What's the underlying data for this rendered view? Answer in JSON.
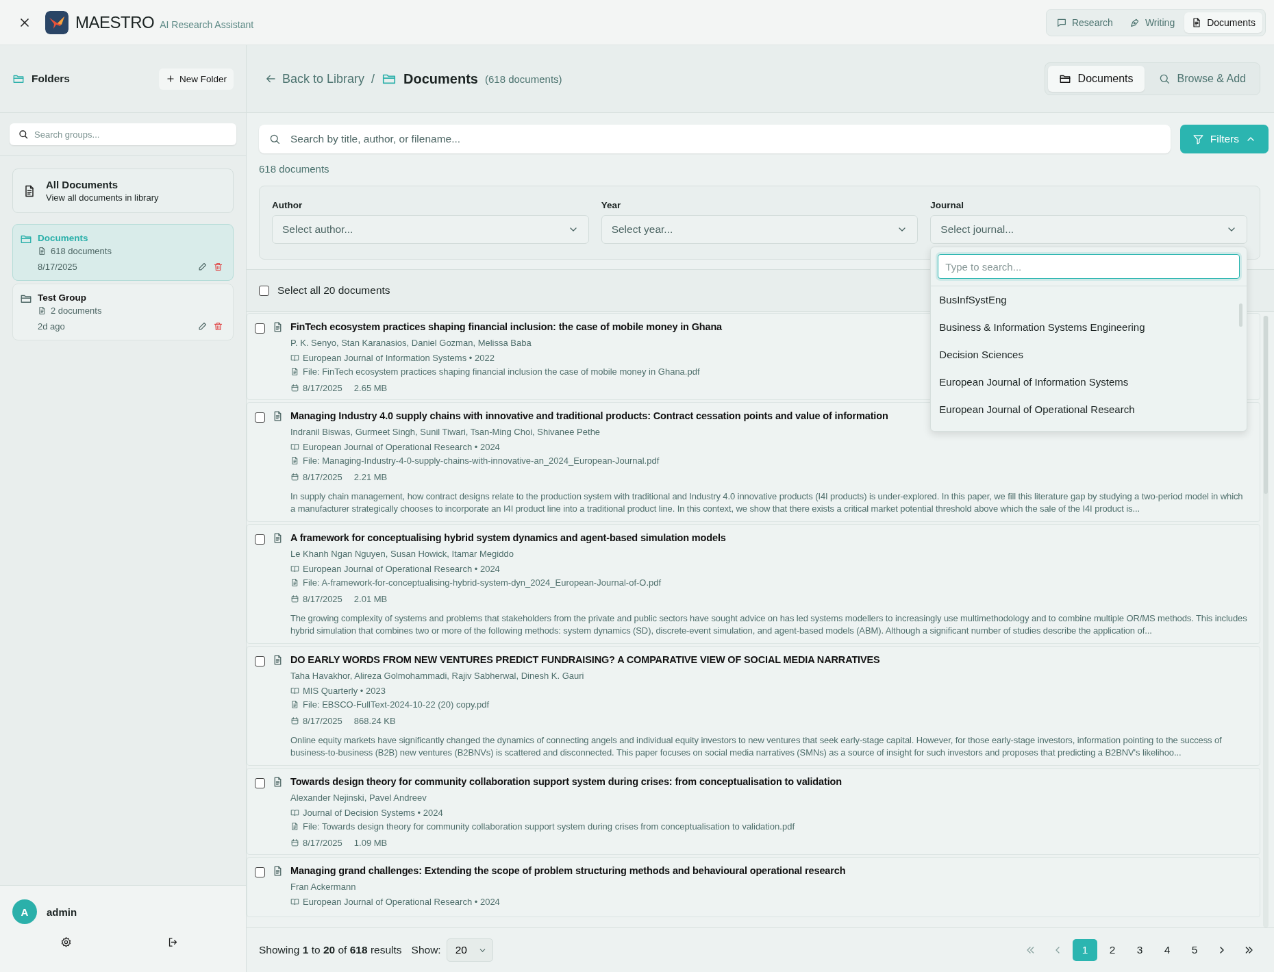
{
  "app": {
    "title": "MAESTRO",
    "subtitle": "AI Research Assistant"
  },
  "nav_tabs": [
    {
      "label": "Research",
      "selected": false,
      "kind": "chat"
    },
    {
      "label": "Writing",
      "selected": false,
      "kind": "pen"
    },
    {
      "label": "Documents",
      "selected": true,
      "kind": "doc"
    }
  ],
  "sidebar": {
    "title": "Folders",
    "new_folder_button": "New Folder",
    "search_placeholder": "Search groups...",
    "all_documents": {
      "title": "All Documents",
      "subtitle": "View all documents in library"
    },
    "groups": [
      {
        "name": "Documents",
        "count": "618 documents",
        "date": "8/17/2025",
        "selected": true
      },
      {
        "name": "Test Group",
        "count": "2 documents",
        "date": "2d ago",
        "selected": false
      }
    ],
    "user": {
      "avatar": "A",
      "name": "admin"
    }
  },
  "main": {
    "back_link": "Back to Library",
    "separator": "/",
    "title": "Documents",
    "count": "(618 documents)",
    "view_tabs": [
      {
        "label": "Documents",
        "selected": true,
        "kind": "folder"
      },
      {
        "label": "Browse & Add",
        "selected": false,
        "kind": "search"
      }
    ],
    "search_placeholder": "Search by title, author, or filename...",
    "filters_button": "Filters",
    "filters_expanded": true,
    "result_count": "618 documents",
    "filters": [
      {
        "label": "Author",
        "placeholder": "Select author...",
        "open": false
      },
      {
        "label": "Year",
        "placeholder": "Select year...",
        "open": false
      },
      {
        "label": "Journal",
        "placeholder": "Select journal...",
        "open": true
      }
    ],
    "dropdown": {
      "placeholder": "Type to search...",
      "options": [
        "BusInfSystEng",
        "Business & Information Systems Engineering",
        "Decision Sciences",
        "European Journal of Information Systems",
        "European Journal of Operational Research"
      ]
    },
    "select_all": {
      "label": "Select all 20 documents",
      "checked": false
    },
    "documents": [
      {
        "title": "FinTech ecosystem practices shaping financial inclusion: the case of mobile money in Ghana",
        "authors": "P. K. Senyo, Stan Karanasios, Daniel Gozman, Melissa Baba",
        "journal": "European Journal of Information Systems • 2022",
        "file": "File: FinTech ecosystem practices shaping financial inclusion the case of mobile money in Ghana.pdf",
        "date": "8/17/2025",
        "size": "2.65 MB",
        "checked": false
      },
      {
        "title": "Managing Industry 4.0 supply chains with innovative and traditional products: Contract cessation points and value of information",
        "authors": "Indranil Biswas, Gurmeet Singh, Sunil Tiwari, Tsan-Ming Choi, Shivanee Pethe",
        "journal": "European Journal of Operational Research • 2024",
        "file": "File: Managing-Industry-4-0-supply-chains-with-innovative-an_2024_European-Journal.pdf",
        "date": "8/17/2025",
        "size": "2.21 MB",
        "checked": false,
        "abstract": "In supply chain management, how contract designs relate to the production system with traditional and Industry 4.0 innovative products (I4I products) is under-explored. In this paper, we fill this literature gap by studying a two-period model in which a manufacturer strategically chooses to incorporate an I4I product line into a traditional product line. In this context, we show that there exists a critical market potential threshold above which the sale of the I4I product is..."
      },
      {
        "title": "A framework for conceptualising hybrid system dynamics and agent-based simulation models",
        "authors": "Le Khanh Ngan Nguyen, Susan Howick, Itamar Megiddo",
        "journal": "European Journal of Operational Research • 2024",
        "file": "File: A-framework-for-conceptualising-hybrid-system-dyn_2024_European-Journal-of-O.pdf",
        "date": "8/17/2025",
        "size": "2.01 MB",
        "checked": false,
        "abstract": "The growing complexity of systems and problems that stakeholders from the private and public sectors have sought advice on has led systems modellers to increasingly use multimethodology and to combine multiple OR/MS methods. This includes hybrid simulation that combines two or more of the following methods: system dynamics (SD), discrete-event simulation, and agent-based models (ABM). Although a significant number of studies describe the application of..."
      },
      {
        "title": "DO EARLY WORDS FROM NEW VENTURES PREDICT FUNDRAISING? A COMPARATIVE VIEW OF SOCIAL MEDIA NARRATIVES",
        "authors": "Taha Havakhor, Alireza Golmohammadi, Rajiv Sabherwal, Dinesh K. Gauri",
        "journal": "MIS Quarterly • 2023",
        "file": "File: EBSCO-FullText-2024-10-22 (20) copy.pdf",
        "date": "8/17/2025",
        "size": "868.24 KB",
        "checked": false,
        "abstract": "Online equity markets have significantly changed the dynamics of connecting angels and individual equity investors to new ventures that seek early-stage capital. However, for those early-stage investors, information pointing to the success of business-to-business (B2B) new ventures (B2BNVs) is scattered and disconnected. This paper focuses on social media narratives (SMNs) as a source of insight for such investors and proposes that predicting a B2BNV's likelihoo..."
      },
      {
        "title": "Towards design theory for community collaboration support system during crises: from conceptualisation to validation",
        "authors": "Alexander Nejinski, Pavel Andreev",
        "journal": "Journal of Decision Systems • 2024",
        "file": "File: Towards design theory for community collaboration support system during crises from conceptualisation to validation.pdf",
        "date": "8/17/2025",
        "size": "1.09 MB",
        "checked": false
      },
      {
        "title": "Managing grand challenges: Extending the scope of problem structuring methods and behavioural operational research",
        "authors": "Fran Ackermann",
        "journal": "European Journal of Operational Research • 2024",
        "checked": false
      }
    ],
    "pagination": {
      "summary": "Showing **1** to **20** of **618** results",
      "show_label": "Show:",
      "page_size": "20",
      "pages": [
        {
          "label": "1",
          "selected": true
        },
        {
          "label": "2",
          "selected": false
        },
        {
          "label": "3",
          "selected": false
        },
        {
          "label": "4",
          "selected": false
        },
        {
          "label": "5",
          "selected": false
        }
      ]
    }
  }
}
